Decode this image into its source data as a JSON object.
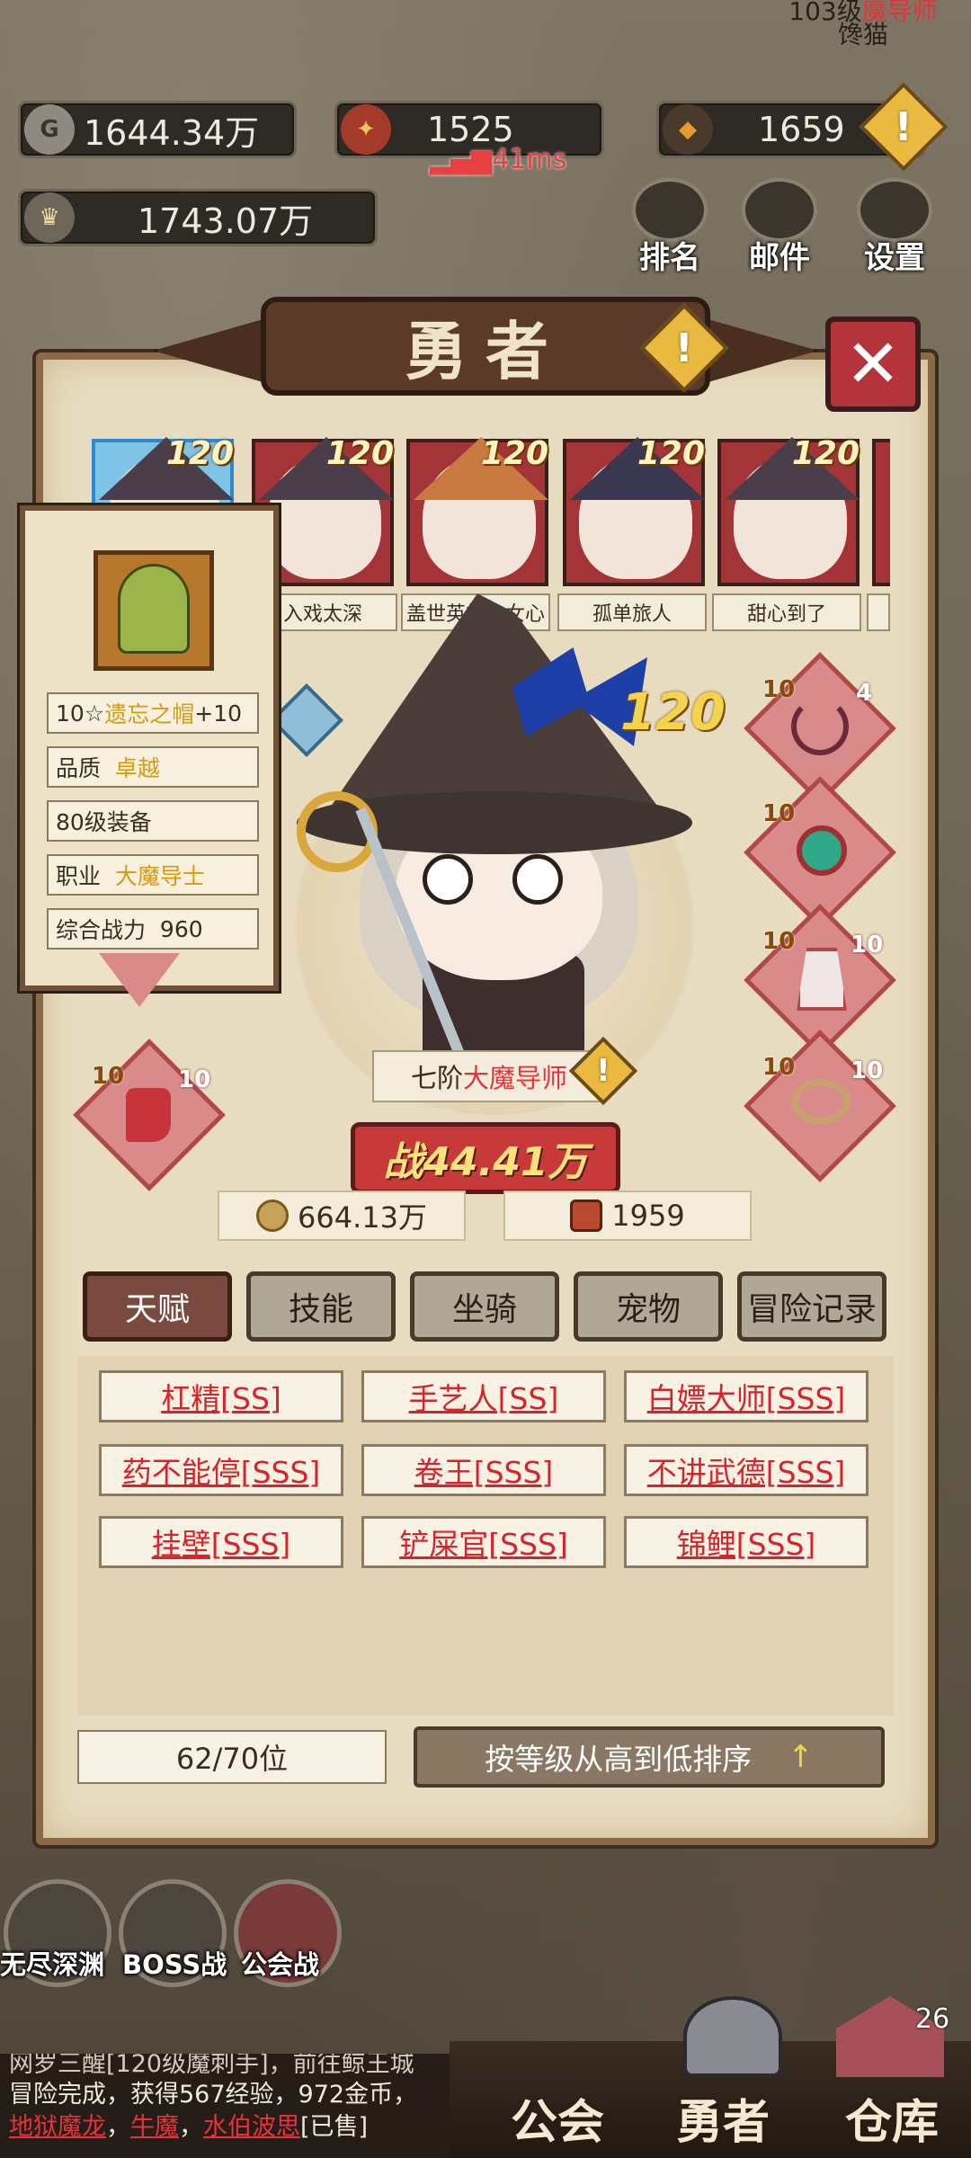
{
  "top_right_player": {
    "level_text": "103级",
    "class_text": "魔导师",
    "name": "馋猫"
  },
  "resources": {
    "gold": "1644.34万",
    "crest": "1525",
    "gem": "1659",
    "power_total": "1743.07万",
    "ping": "41ms"
  },
  "top_menu": {
    "rank": "排名",
    "mail": "邮件",
    "settings": "设置"
  },
  "panel": {
    "title": "勇者",
    "close": "✕"
  },
  "hero_cards": [
    {
      "name": "",
      "level": "120"
    },
    {
      "name": "入戏太深",
      "level": "120"
    },
    {
      "name": "盖世英雄少女心",
      "level": "120"
    },
    {
      "name": "孤单旅人",
      "level": "120"
    },
    {
      "name": "甜心到了",
      "level": "120"
    }
  ],
  "equip_tooltip": {
    "name_prefix": "10☆",
    "name": "遗忘之帽",
    "name_suffix": "+10",
    "quality_label": "品质",
    "quality_value": "卓越",
    "level_text": "80级装备",
    "class_label": "职业",
    "class_value": "大魔导士",
    "power_label": "综合战力",
    "power_value": "960"
  },
  "hero": {
    "level": "120",
    "rank_prefix": "七阶",
    "rank_class": "大魔导师",
    "power_label": "战",
    "power_value": "44.41万",
    "gold": "664.13万",
    "crest": "1959"
  },
  "equip_slots": [
    {
      "star": "10",
      "enh": "4"
    },
    {
      "star": "10",
      "enh": ""
    },
    {
      "star": "10",
      "enh": "10"
    },
    {
      "star": "10",
      "enh": "10"
    },
    {
      "star": "10",
      "enh": "10"
    }
  ],
  "tabs": [
    "天赋",
    "技能",
    "坐骑",
    "宠物",
    "冒险记录"
  ],
  "talents": [
    "杠精[SS]",
    "手艺人[SS]",
    "白嫖大师[SSS]",
    "药不能停[SSS]",
    "卷王[SSS]",
    "不讲武德[SSS]",
    "挂壁[SSS]",
    "铲屎官[SSS]",
    "锦鲤[SSS]"
  ],
  "footer": {
    "count": "62/70位",
    "sort": "按等级从高到低排序",
    "sort_icon": "↑"
  },
  "bottom_modes": [
    "无尽深渊",
    "BOSS战",
    "公会战"
  ],
  "chat": {
    "line1": "网罗三醒[120级魔刺手]，前往鲸王城",
    "line2": "冒险完成，获得567经验，972金币，",
    "loot1": "地狱魔龙",
    "loot2": "牛魔",
    "loot3": "水伯波思",
    "sold": "[已售]"
  },
  "bottom_nav": {
    "guild": "公会",
    "hero": "勇者",
    "warehouse": "仓库",
    "warehouse_badge": "26"
  },
  "colors": {
    "panel_bg": "#e8dcc0",
    "accent_red": "#d8232a",
    "gold_text": "#d89a10",
    "tab_active": "#7a4a40"
  }
}
